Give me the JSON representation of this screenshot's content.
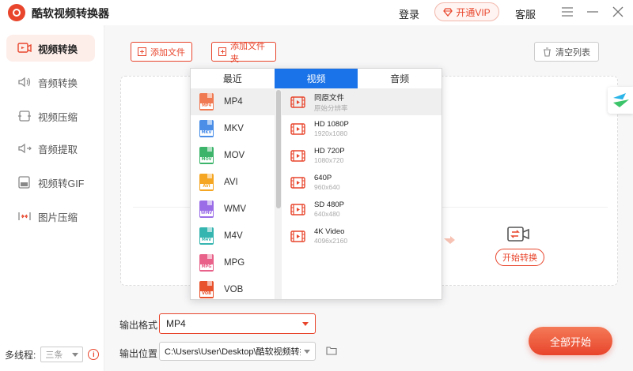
{
  "app": {
    "title": "酷软视频转换器"
  },
  "header": {
    "login": "登录",
    "vip": "开通VIP",
    "service": "客服"
  },
  "sidebar": {
    "items": [
      {
        "label": "视频转换",
        "icon": "video-convert-icon",
        "active": true
      },
      {
        "label": "音频转换",
        "icon": "audio-convert-icon"
      },
      {
        "label": "视频压缩",
        "icon": "video-compress-icon"
      },
      {
        "label": "音频提取",
        "icon": "audio-extract-icon"
      },
      {
        "label": "视频转GIF",
        "icon": "video-gif-icon"
      },
      {
        "label": "图片压缩",
        "icon": "image-compress-icon"
      }
    ],
    "threads_label": "多线程:",
    "threads_value": "三条"
  },
  "toolbar": {
    "add_file": "添加文件",
    "add_folder": "添加文件夹",
    "clear_list": "清空列表"
  },
  "dropzone": {
    "start_convert": "开始转换"
  },
  "popup": {
    "tabs": [
      "最近",
      "视频",
      "音频"
    ],
    "active_tab": 1,
    "formats": [
      {
        "name": "MP4",
        "color": "#f07a52",
        "badge": "MP4"
      },
      {
        "name": "MKV",
        "color": "#4a8ee8",
        "badge": "MKV"
      },
      {
        "name": "MOV",
        "color": "#3cb56a",
        "badge": "MOV"
      },
      {
        "name": "AVI",
        "color": "#f5a623",
        "badge": "AVI"
      },
      {
        "name": "WMV",
        "color": "#9b6ee8",
        "badge": "WMV"
      },
      {
        "name": "M4V",
        "color": "#35b5b0",
        "badge": "M4V"
      },
      {
        "name": "MPG",
        "color": "#e8628a",
        "badge": "MPG"
      },
      {
        "name": "VOB",
        "color": "#e8522c",
        "badge": "VOB"
      }
    ],
    "selected_format": 0,
    "resolutions": [
      {
        "title": "同原文件",
        "sub": "原始分辨率"
      },
      {
        "title": "HD 1080P",
        "sub": "1920x1080"
      },
      {
        "title": "HD 720P",
        "sub": "1080x720"
      },
      {
        "title": "640P",
        "sub": "960x640"
      },
      {
        "title": "SD 480P",
        "sub": "640x480"
      },
      {
        "title": "4K Video",
        "sub": "4096x2160"
      }
    ],
    "selected_resolution": 0
  },
  "output": {
    "format_label": "输出格式",
    "format_value": "MP4",
    "path_label": "输出位置",
    "path_value": "C:\\Users\\User\\Desktop\\酷软视频转换器"
  },
  "start_all": "全部开始",
  "colors": {
    "accent": "#e8452c",
    "tab_blue": "#1a73e8"
  }
}
